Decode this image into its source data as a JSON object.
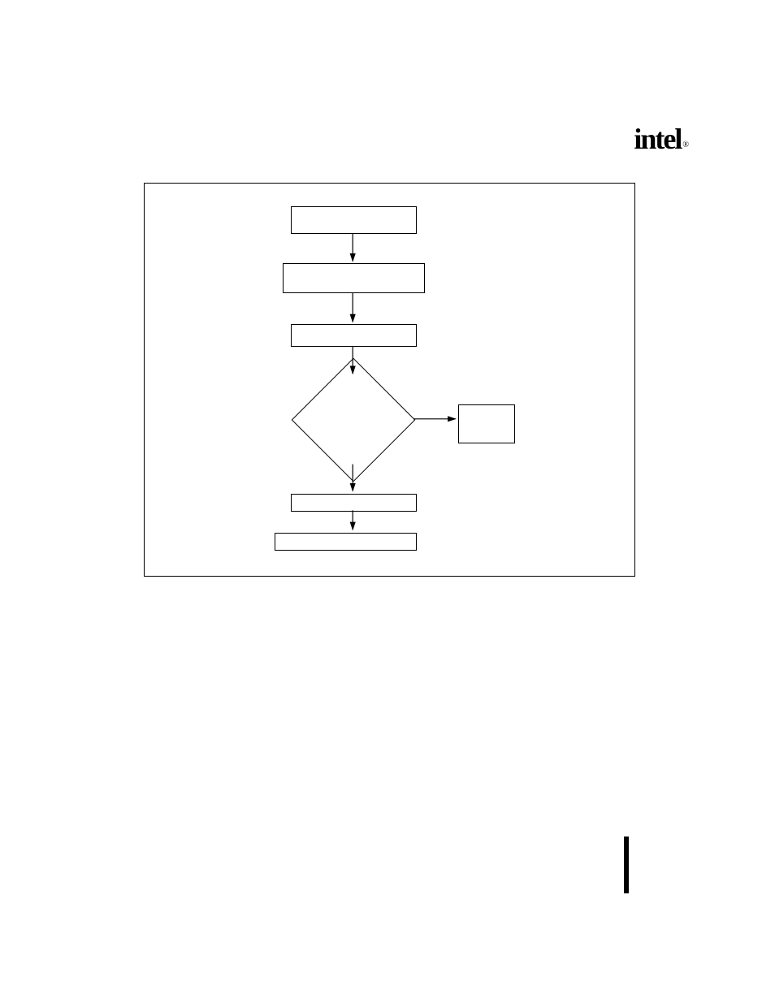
{
  "boxes": {
    "b1": "",
    "b2": "",
    "b3": "",
    "b4": "",
    "b5": "",
    "decision": "",
    "out": ""
  },
  "logo": "intel",
  "reg": "®"
}
